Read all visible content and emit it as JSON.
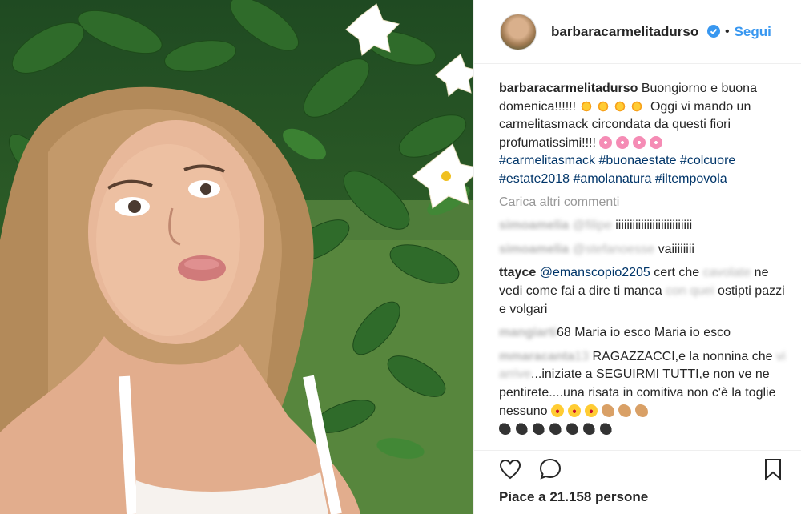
{
  "post": {
    "username": "barbaracarmelitadurso",
    "follow_label": "Segui",
    "separator": "•",
    "caption_user": "barbaracarmelitadurso",
    "caption_line1": " Buongiorno e buona domenica!!!!!! ",
    "caption_line2": " Oggi vi mando un carmelitasmack circondata da questi fiori profumatissimi!!!! ",
    "hashtags": [
      "#carmelitasmack",
      "#buonaestate",
      "#colcuore",
      "#estate2018",
      "#amolanatura",
      "#iltempovola"
    ],
    "load_more": "Carica altri commenti",
    "likes": "Piace a 21.158 persone"
  },
  "comments": [
    {
      "user": "simoamelia",
      "mention": "@filipe",
      "text": " iiiiiiiiiiiiiiiiiiiiiiiiiii"
    },
    {
      "user": "simoamelia",
      "mention": "@stefanoesse",
      "text": " vaiiiiiiii"
    },
    {
      "user": "ttayce",
      "mention": "@emanscopio2205",
      "text": " cert che",
      "text2": "cavolate",
      "text3": " ne vedi come fai a dire ti manca",
      "text4": "con quei",
      "text5": " ostipti pazzi e volgari"
    },
    {
      "user": "mangiarti",
      "suffix": "68",
      "text": " Maria io esco Maria io esco"
    },
    {
      "user": "mmaracanta",
      "suffix": "13",
      "text": " RAGAZZACCI,e la nonnina",
      "text2": "che ",
      "blur2": "vi arrive",
      "text3": "...iniziate a SEGUIRMI TUTTI,e non ve ne pentirete....una risata in comitiva non c'è la toglie nessuno "
    }
  ],
  "colors": {
    "link": "#3897f0",
    "hashtag": "#003569",
    "muted": "#999999",
    "text": "#262626"
  },
  "icons": [
    "verified-badge-icon",
    "heart-icon",
    "comment-icon",
    "bookmark-icon",
    "sun-emoji",
    "flower-emoji",
    "smile-emoji",
    "flex-arm-emoji",
    "bomb-emoji"
  ]
}
